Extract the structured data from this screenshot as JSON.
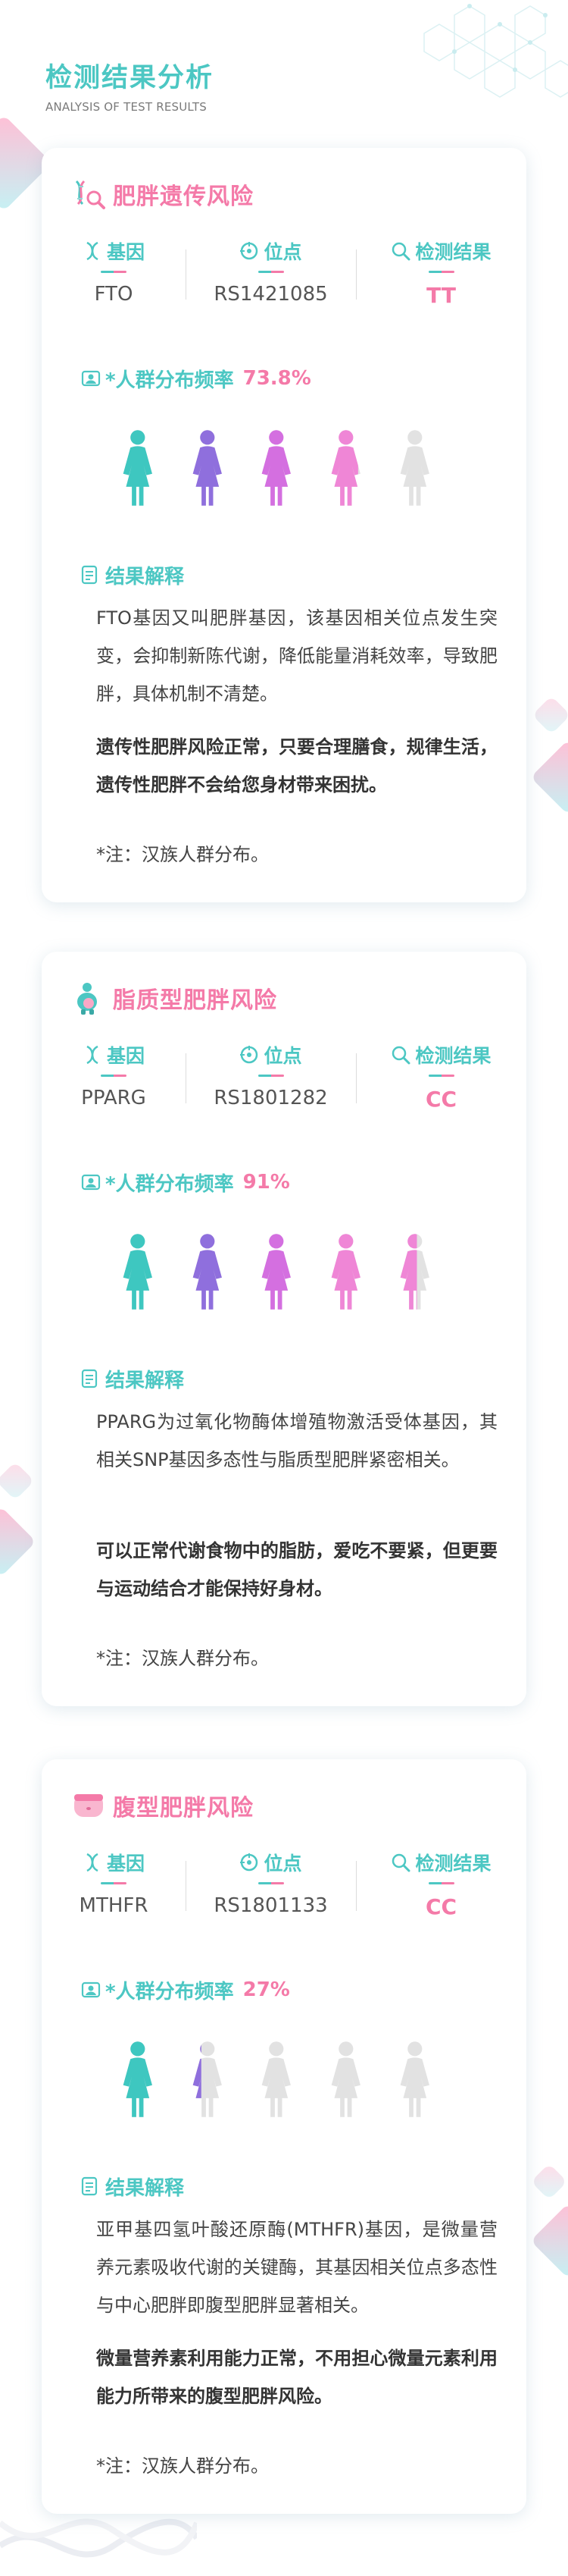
{
  "header": {
    "title": "检测结果分析",
    "subtitle": "ANALYSIS OF TEST RESULTS"
  },
  "labels": {
    "gene": "基因",
    "locus": "位点",
    "result": "检测结果",
    "frequency": "*人群分布频率",
    "interpretation": "结果解释"
  },
  "colors": {
    "accent_teal": "#4cc7c3",
    "accent_pink": "#f47aa8",
    "figure_palette": [
      "#3ec7c0",
      "#8f6fdd",
      "#d46fe0",
      "#ef86d6",
      "#e2e2e2"
    ]
  },
  "cards": [
    {
      "title": "肥胖遗传风险",
      "icon": "dna-magnifier-icon",
      "gene": "FTO",
      "locus": "RS1421085",
      "result": "TT",
      "frequency": "73.8%",
      "population_fill": [
        1,
        1,
        1,
        0.8,
        0
      ],
      "paragraphs": [
        "FTO基因又叫肥胖基因，该基因相关位点发生突变，会抑制新陈代谢，降低能量消耗效率，导致肥胖，具体机制不清楚。",
        "遗传性肥胖风险正常，只要合理膳食，规律生活，遗传性肥胖不会给您身材带来困扰。"
      ],
      "note": "*注：汉族人群分布。"
    },
    {
      "title": "脂质型肥胖风险",
      "icon": "chubby-person-icon",
      "gene": "PPARG",
      "locus": "RS1801282",
      "result": "CC",
      "frequency": "91%",
      "population_fill": [
        1,
        1,
        1,
        1,
        0.55
      ],
      "paragraphs": [
        "PPARG为过氧化物酶体增殖物激活受体基因，其相关SNP基因多态性与脂质型肥胖紧密相关。",
        "可以正常代谢食物中的脂肪，爱吃不要紧，但更要与运动结合才能保持好身材。"
      ],
      "note": "*注：汉族人群分布。"
    },
    {
      "title": "腹型肥胖风险",
      "icon": "belly-icon",
      "gene": "MTHFR",
      "locus": "RS1801133",
      "result": "CC",
      "frequency": "27%",
      "population_fill": [
        1,
        0.35,
        0,
        0,
        0
      ],
      "paragraphs": [
        "亚甲基四氢叶酸还原酶(MTHFR)基因，是微量营养元素吸收代谢的关键酶，其基因相关位点多态性与中心肥胖即腹型肥胖显著相关。",
        "微量营养素利用能力正常，不用担心微量元素利用能力所带来的腹型肥胖风险。"
      ],
      "note": "*注：汉族人群分布。"
    }
  ]
}
